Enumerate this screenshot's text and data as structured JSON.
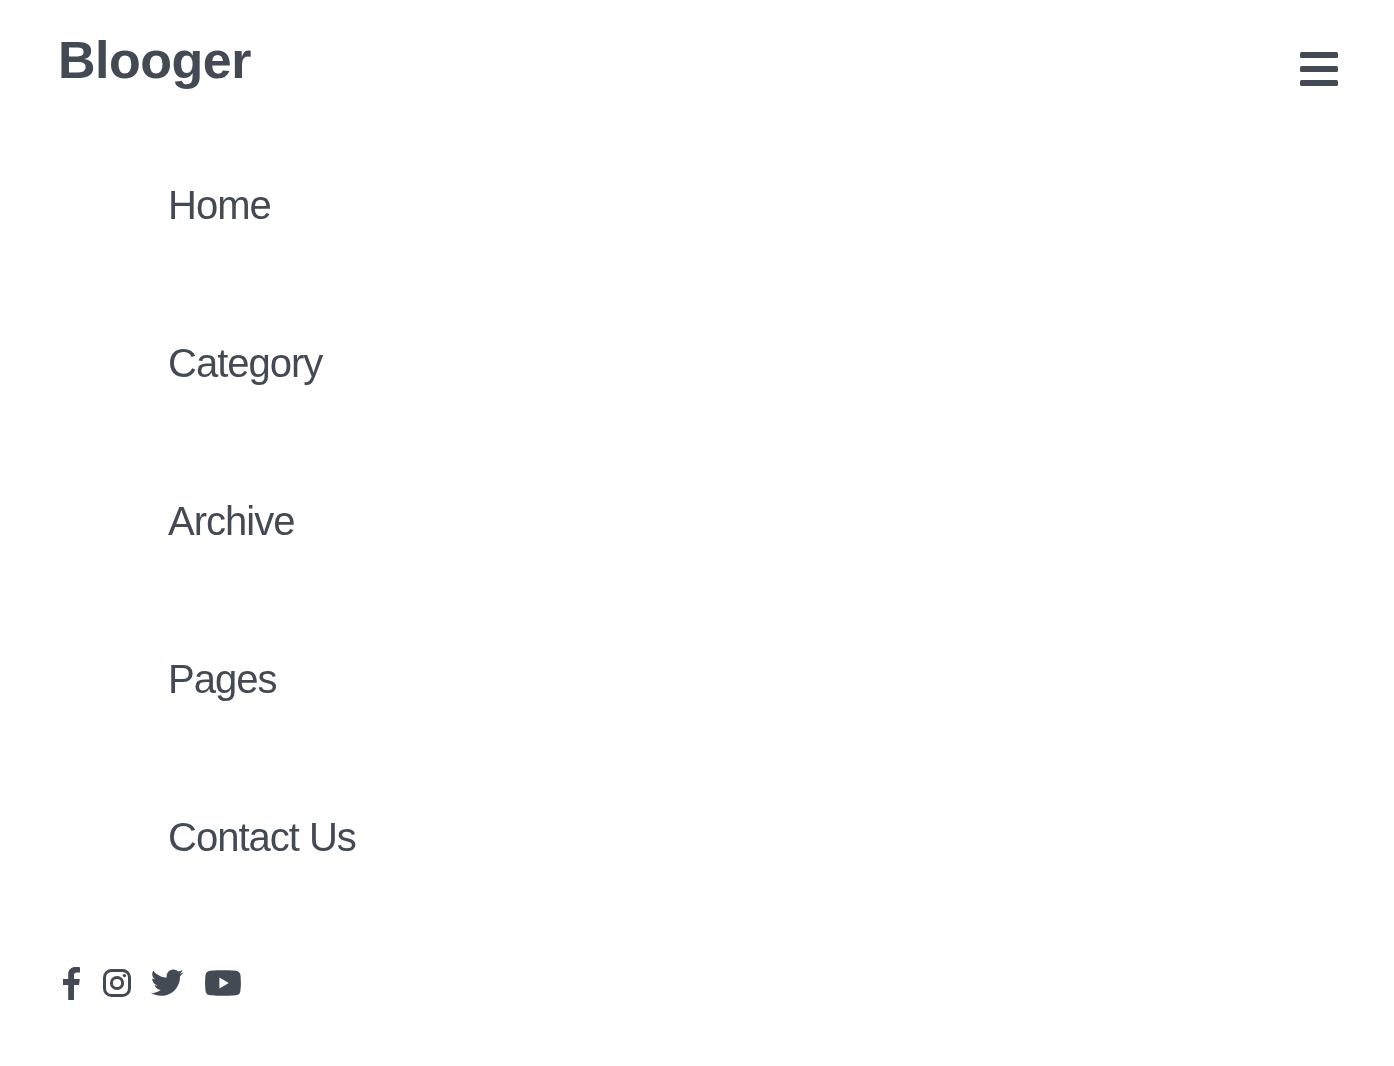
{
  "brand": "Blooger",
  "nav": {
    "items": [
      {
        "label": "Home"
      },
      {
        "label": "Category"
      },
      {
        "label": "Archive"
      },
      {
        "label": "Pages"
      },
      {
        "label": "Contact Us"
      }
    ]
  }
}
